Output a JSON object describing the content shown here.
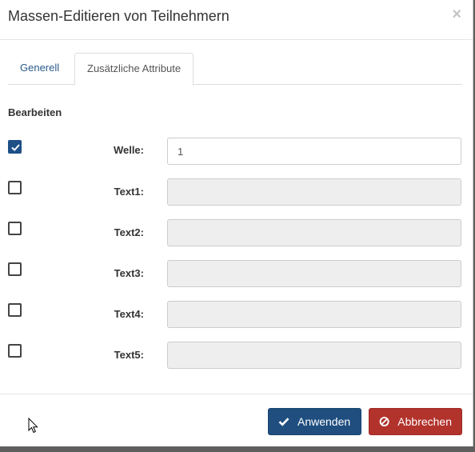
{
  "dialog": {
    "title": "Massen-Editieren von Teilnehmern",
    "close_symbol": "×"
  },
  "tabs": [
    {
      "label": "Generell",
      "active": false
    },
    {
      "label": "Zusätzliche Attribute",
      "active": true
    }
  ],
  "section_title": "Bearbeiten",
  "fields": [
    {
      "label": "Welle:",
      "value": "1",
      "checked": true,
      "enabled": true
    },
    {
      "label": "Text1:",
      "value": "",
      "checked": false,
      "enabled": false
    },
    {
      "label": "Text2:",
      "value": "",
      "checked": false,
      "enabled": false
    },
    {
      "label": "Text3:",
      "value": "",
      "checked": false,
      "enabled": false
    },
    {
      "label": "Text4:",
      "value": "",
      "checked": false,
      "enabled": false
    },
    {
      "label": "Text5:",
      "value": "",
      "checked": false,
      "enabled": false
    }
  ],
  "footer": {
    "apply_label": "Anwenden",
    "apply_icon": "checkmark-icon",
    "cancel_label": "Abbrechen",
    "cancel_icon": "ban-icon"
  },
  "colors": {
    "primary": "#1f4e7f",
    "danger": "#b2322c",
    "link": "#2a5a8a"
  }
}
